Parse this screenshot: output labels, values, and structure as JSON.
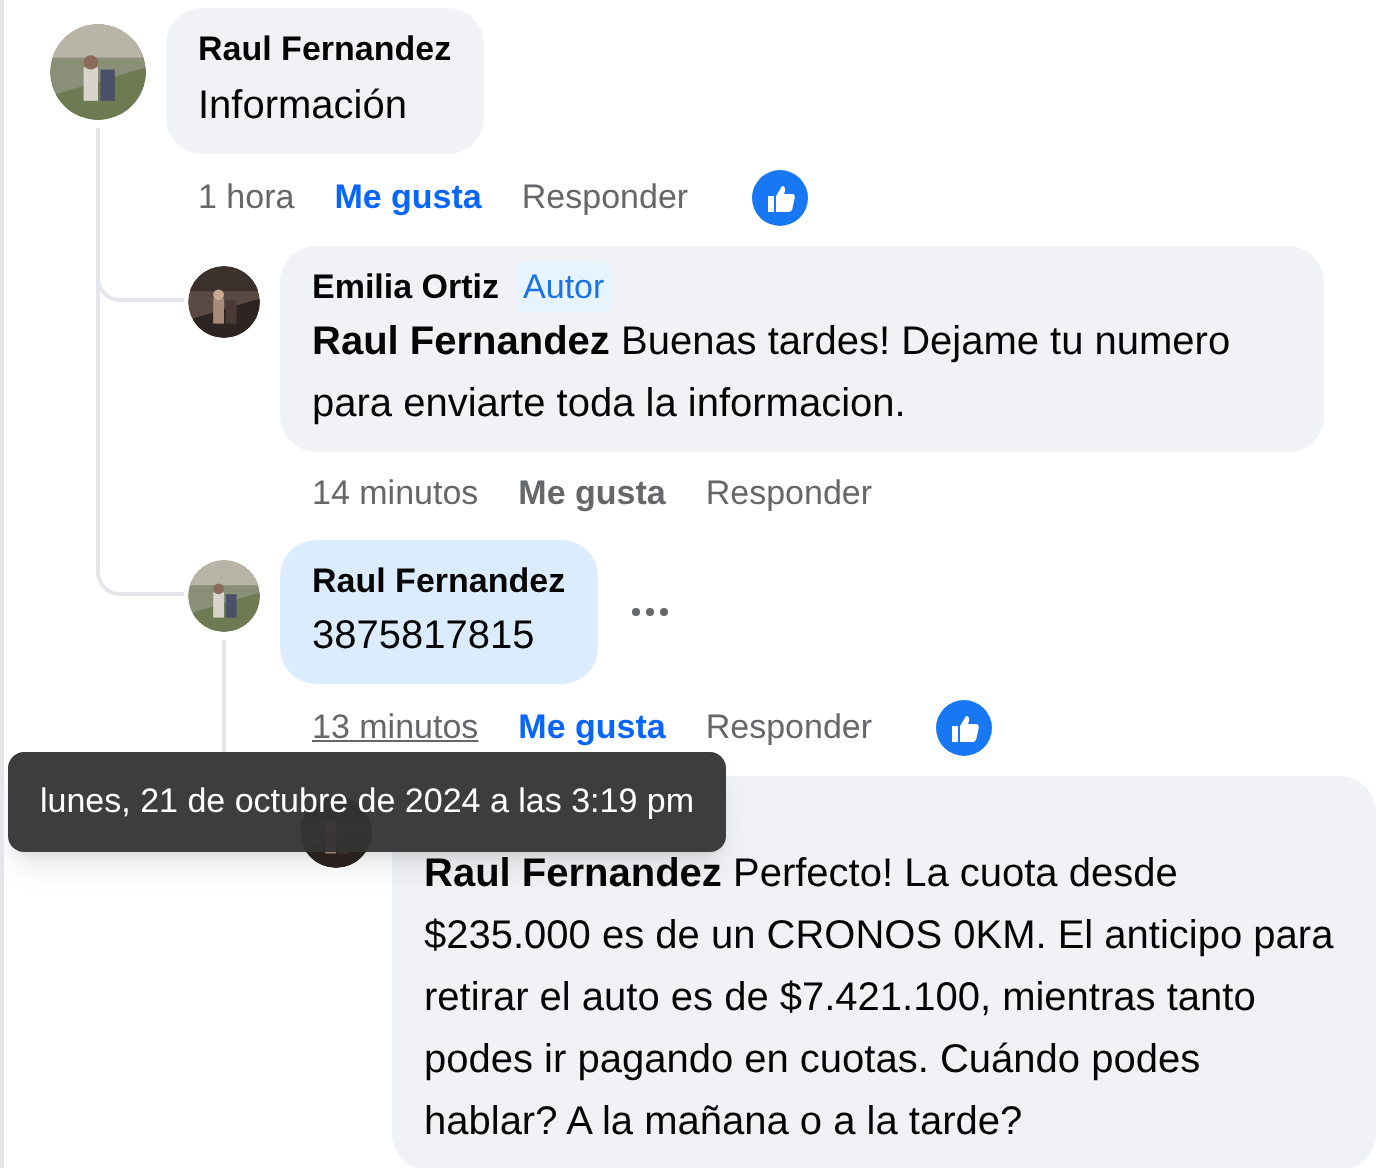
{
  "comments": [
    {
      "author": "Raul Fernandez",
      "text": "Información",
      "time": "1 hora",
      "like": "Me gusta",
      "reply": "Responder",
      "liked": true,
      "reaction": true,
      "children": [
        {
          "author": "Emilia Ortiz",
          "badge": "Autor",
          "text": "**Raul Fernandez** Buenas tardes! Dejame tu numero para enviarte toda la informacion.",
          "time": "14 minutos",
          "like": "Me gusta",
          "reply": "Responder",
          "liked": false
        },
        {
          "author": "Raul Fernandez",
          "text": "3875817815",
          "time": "13 minutos",
          "like": "Me gusta",
          "reply": "Responder",
          "liked": true,
          "reaction": true,
          "highlighted": true,
          "time_hovered": true,
          "menu": true,
          "children": [
            {
              "text": "**Raul Fernandez** Perfecto! La cuota desde $235.000 es de un CRONOS 0KM. El anticipo para retirar el auto es de $7.421.100, mientras tanto podes ir pagando en cuotas. Cuándo podes hablar? A la mañana o a la tarde?"
            }
          ]
        }
      ]
    }
  ],
  "tooltip": {
    "text": "lunes, 21 de octubre de 2024 a las 3:19 pm"
  }
}
